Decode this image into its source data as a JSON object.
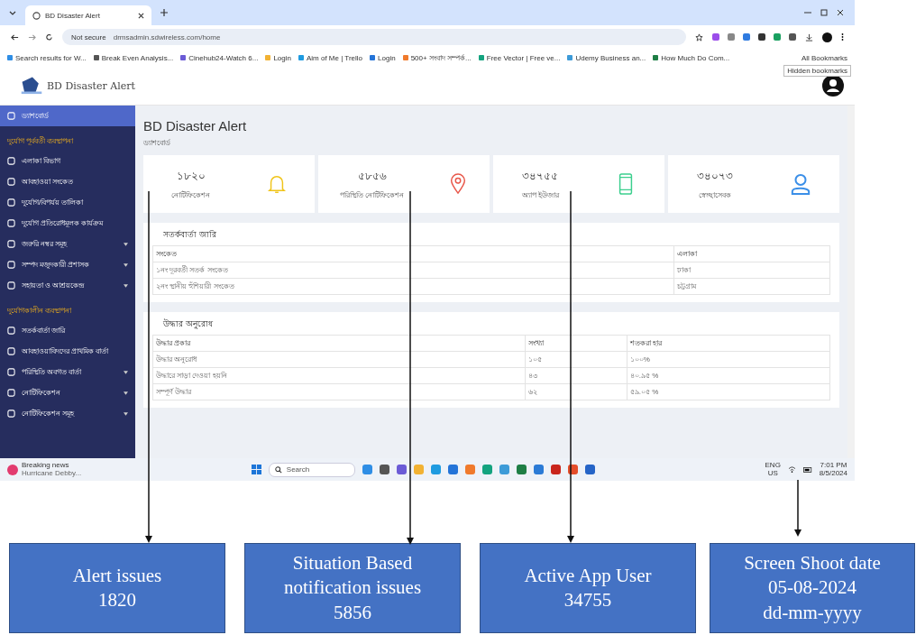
{
  "browser": {
    "tab_title": "BD Disaster Alert",
    "security": "Not secure",
    "url": "drmsadmin.sdwireless.com/home",
    "bookmarks": [
      "Search results for W...",
      "Break Even Analysis...",
      "Cinehub24-Watch 6...",
      "Login",
      "Aim of Me | Trello",
      "Login",
      "500+ সংবাদ সম্পর্ক...",
      "Free Vector | Free ve...",
      "Udemy Business an...",
      "How Much Do Com..."
    ],
    "all_bookmarks": "All Bookmarks",
    "tooltip": "Hidden bookmarks"
  },
  "app": {
    "logo_title": "BD Disaster Alert",
    "page_title": "BD Disaster Alert",
    "breadcrumb": "ড্যাশবোর্ড"
  },
  "sidebar": {
    "items": [
      {
        "kind": "item",
        "label": "ড্যাশবোর্ড",
        "selected": true,
        "expandable": false
      },
      {
        "kind": "section",
        "label": "দুর্যোগ পূর্ববর্তী ব্যবস্থাপনা"
      },
      {
        "kind": "item",
        "label": "এলাকা বিভাগ",
        "selected": false,
        "expandable": false
      },
      {
        "kind": "item",
        "label": "আবহাওয়া সংকেত",
        "selected": false,
        "expandable": false
      },
      {
        "kind": "item",
        "label": "দুর্যোগ/বিপর্যয় তালিকা",
        "selected": false,
        "expandable": false
      },
      {
        "kind": "item",
        "label": "দুর্যোগ প্রতিরোধমূলক কার্যক্রম",
        "selected": false,
        "expandable": false
      },
      {
        "kind": "item",
        "label": "জরুরি নম্বর সমূহ",
        "selected": false,
        "expandable": true
      },
      {
        "kind": "item",
        "label": "সম্পদ মজুদকারী প্রশাসক",
        "selected": false,
        "expandable": true
      },
      {
        "kind": "item",
        "label": "সহায়তা ও আশ্রয়কেন্দ্র",
        "selected": false,
        "expandable": true
      },
      {
        "kind": "section",
        "label": "দুর্যোগকালীন ব্যবস্থাপনা"
      },
      {
        "kind": "item",
        "label": "সতর্কবার্তা জারি",
        "selected": false,
        "expandable": false
      },
      {
        "kind": "item",
        "label": "আবহাওয়াবিদদের প্রাথমিক বার্তা",
        "selected": false,
        "expandable": false
      },
      {
        "kind": "item",
        "label": "পরিস্থিতি অবগত বার্তা",
        "selected": false,
        "expandable": true
      },
      {
        "kind": "item",
        "label": "নোটিফিকেশন",
        "selected": false,
        "expandable": true
      },
      {
        "kind": "item",
        "label": "নোটিফিকেশন সমূহ",
        "selected": false,
        "expandable": true
      }
    ]
  },
  "stats": [
    {
      "value": "১৮২০",
      "label": "নোটিফিকেশন",
      "kind": "bell",
      "color": "#f0c419"
    },
    {
      "value": "৫৮৫৬",
      "label": "পরিস্থিতি নোটিফিকেশন",
      "kind": "pin",
      "color": "#e8574a"
    },
    {
      "value": "৩৪৭৫৫",
      "label": "অ্যাপ ইউজার",
      "kind": "phone",
      "color": "#3ccf8e"
    },
    {
      "value": "৩৪০৭৩",
      "label": "স্বেচ্ছাসেবক",
      "kind": "person",
      "color": "#3b8fe8"
    }
  ],
  "tables": [
    {
      "title": "সতর্কবার্তা জারি",
      "columns": [
        "সংকেত",
        "এলাকা"
      ],
      "rows": [
        [
          "১নং দূরবর্তী সতর্ক সংকেত",
          "ঢাকা"
        ],
        [
          "২নং স্থানীয় হুঁশিয়ারী সংকেত",
          "চট্টগ্রাম"
        ]
      ]
    },
    {
      "title": "উদ্ধার অনুরোধ",
      "columns": [
        "উদ্ধার প্রকার",
        "সংখ্যা",
        "শতকরা হার"
      ],
      "rows": [
        [
          "উদ্ধার অনুরোধ",
          "১০৫",
          "১০০%"
        ],
        [
          "উদ্ধারে সাড়া দেওয়া হয়নি",
          "৪৩",
          "৪০.৯৫ %"
        ],
        [
          "সম্পূর্ণ উদ্ধার",
          "৬২",
          "৫৯.০৫ %"
        ]
      ]
    }
  ],
  "taskbar": {
    "news_title": "Breaking news",
    "news_subtitle": "Hurricane Debby...",
    "search_placeholder": "Search",
    "lang": "ENG",
    "region": "US",
    "time": "7:01 PM",
    "date": "8/5/2024"
  },
  "annotations": [
    {
      "lines": [
        "Alert issues",
        "1820"
      ]
    },
    {
      "lines": [
        "Situation Based",
        "notification issues",
        "5856"
      ]
    },
    {
      "lines": [
        "Active App User",
        "34755"
      ]
    },
    {
      "lines": [
        "Screen Shoot date",
        "05-08-2024",
        "dd-mm-yyyy"
      ]
    }
  ]
}
